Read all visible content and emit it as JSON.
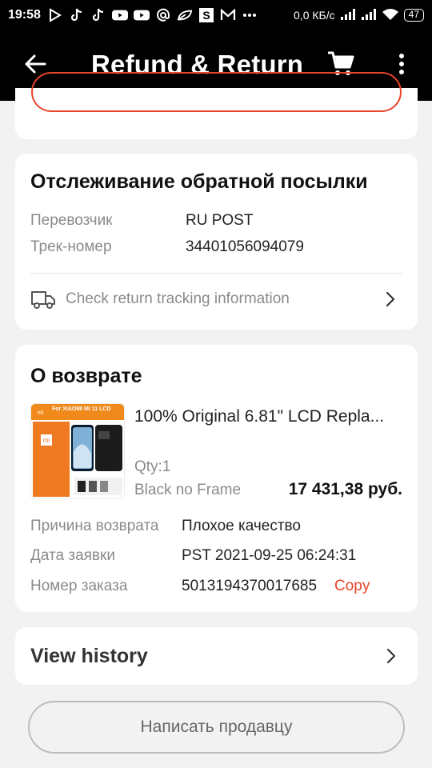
{
  "status_bar": {
    "time": "19:58",
    "network_speed": "0,0 КБ/с",
    "battery": "47",
    "notification_icons": [
      "play-store-icon",
      "tiktok-icon",
      "tiktok-icon",
      "youtube-icon",
      "youtube-icon",
      "at-icon",
      "leaf-icon",
      "s-icon",
      "gmail-icon",
      "dots-icon"
    ]
  },
  "app_bar": {
    "title": "Refund & Return",
    "background": "#000000"
  },
  "tracking": {
    "title": "Отслеживание обратной посылки",
    "carrier_label": "Перевозчик",
    "carrier_value": "RU POST",
    "tracking_label": "Трек-номер",
    "tracking_value": "34401056094079",
    "link_text": "Check return tracking information"
  },
  "return_info": {
    "title": "О возврате",
    "product": {
      "title": "100% Original 6.81\" LCD Repla...",
      "image_caption": "For XIAOMI Mi 11 LCD",
      "qty": "Qty:1",
      "variant": "Black no Frame",
      "price": "17 431,38 руб."
    },
    "reason_label": "Причина возврата",
    "reason_value": "Плохое качество",
    "date_label": "Дата заявки",
    "date_value": "PST 2021-09-25 06:24:31",
    "order_label": "Номер заказа",
    "order_value": "5013194370017685",
    "copy_label": "Copy"
  },
  "history": {
    "label": "View history"
  },
  "contact_button": {
    "label": "Написать продавцу"
  },
  "colors": {
    "accent": "#e8452c",
    "page_bg": "#f2f2f2",
    "card_bg": "#ffffff"
  }
}
